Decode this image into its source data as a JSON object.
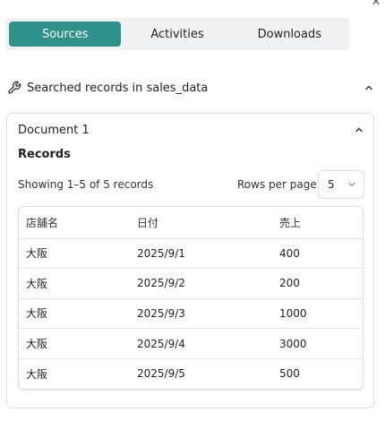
{
  "tabs": [
    {
      "label": "Sources",
      "active": true
    },
    {
      "label": "Activities",
      "active": false
    },
    {
      "label": "Downloads",
      "active": false
    }
  ],
  "section": {
    "title": "Searched records in sales_data",
    "icon": "wrench-icon"
  },
  "document": {
    "title": "Document 1",
    "records_heading": "Records",
    "showing_text": "Showing 1–5 of 5 records",
    "rows_per_page_label": "Rows per page",
    "rows_per_page_value": "5"
  },
  "table": {
    "headers": [
      "店舗名",
      "日付",
      "売上"
    ],
    "rows": [
      [
        "大阪",
        "2025/9/1",
        "400"
      ],
      [
        "大阪",
        "2025/9/2",
        "200"
      ],
      [
        "大阪",
        "2025/9/3",
        "1000"
      ],
      [
        "大阪",
        "2025/9/4",
        "3000"
      ],
      [
        "大阪",
        "2025/9/5",
        "500"
      ]
    ]
  },
  "colors": {
    "accent": "#2e918a",
    "tab_bar_bg": "#f0f1f2",
    "border": "#dcdcdc"
  }
}
